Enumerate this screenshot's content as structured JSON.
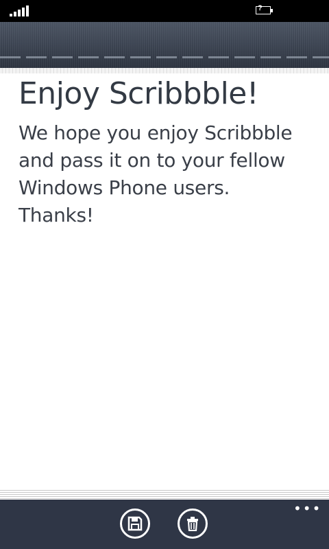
{
  "status_bar": {
    "signal_icon": "signal-strength-icon",
    "battery_icon": "battery-unknown-icon",
    "battery_glyph": "?"
  },
  "header": {
    "style": "stitched-fabric"
  },
  "note": {
    "title": "Enjoy Scribbble!",
    "lines": [
      "We hope you enjoy Scribbble",
      "and pass it on to your fellow",
      "Windows Phone users.",
      "Thanks!"
    ]
  },
  "app_bar": {
    "buttons": [
      {
        "icon": "save-icon"
      },
      {
        "icon": "delete-icon"
      }
    ],
    "more_glyph": "•••"
  },
  "colors": {
    "status_bar": "#000000",
    "header": "#3d4553",
    "app_bar": "#2f3646",
    "text": "#333a44"
  }
}
